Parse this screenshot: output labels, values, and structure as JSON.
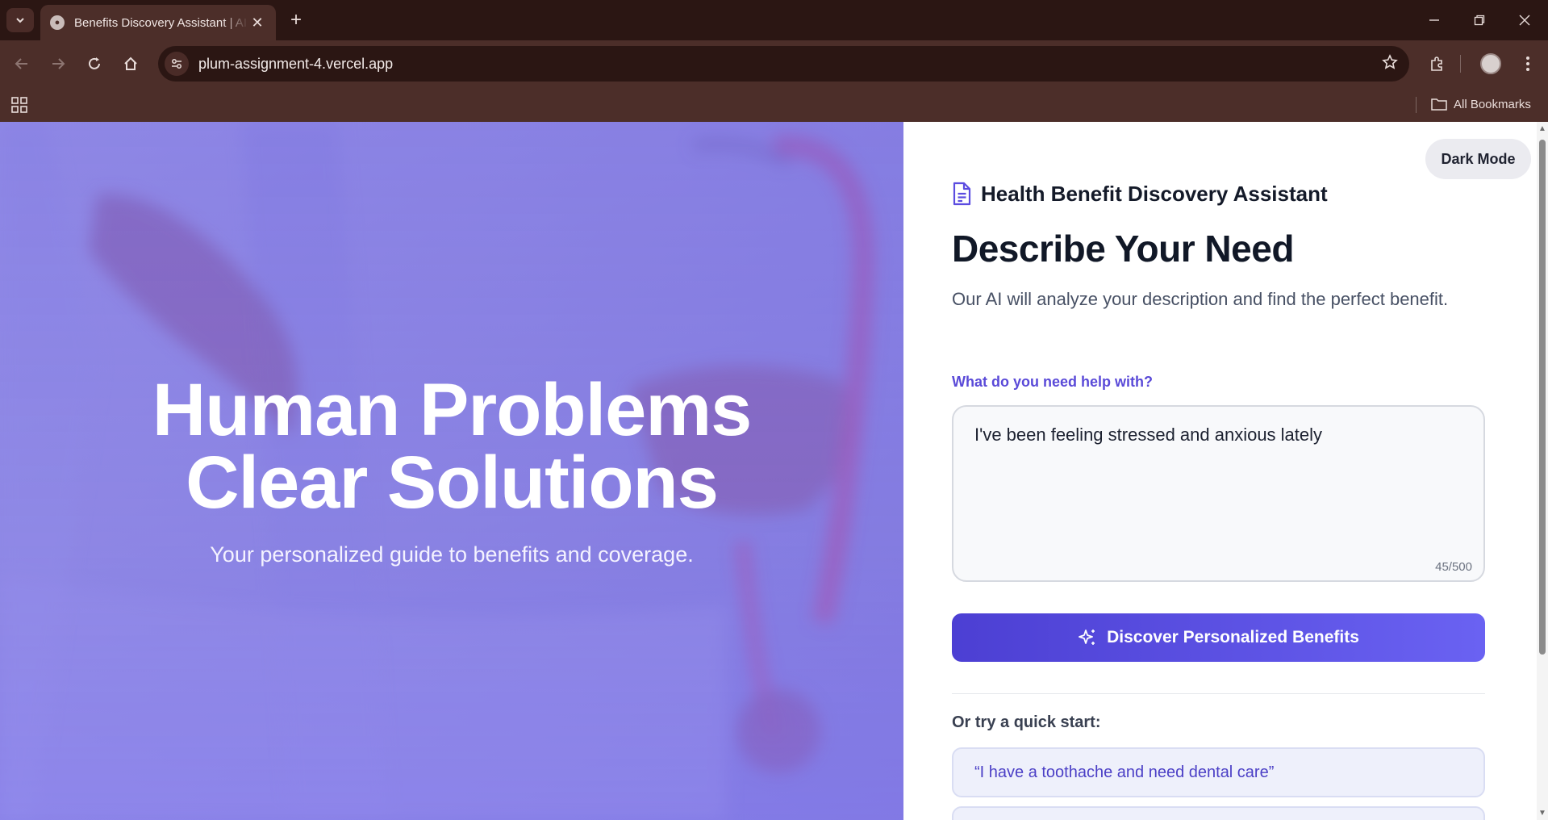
{
  "browser": {
    "tab_title": "Benefits Discovery Assistant | AI",
    "url": "plum-assignment-4.vercel.app",
    "all_bookmarks": "All Bookmarks"
  },
  "hero": {
    "title_line1": "Human Problems",
    "title_line2": "Clear Solutions",
    "subtitle": "Your personalized guide to benefits and coverage."
  },
  "panel": {
    "dark_mode_label": "Dark Mode",
    "app_name": "Health Benefit Discovery Assistant",
    "heading": "Describe Your Need",
    "lede": "Our AI will analyze your description and find the perfect benefit.",
    "field_label": "What do you need help with?",
    "input_value": "I've been feeling stressed and anxious lately",
    "char_count": "45/500",
    "cta_label": "Discover Personalized Benefits",
    "quick_start_title": "Or try a quick start:",
    "quick_starts": [
      "“I have a toothache and need dental care”",
      ""
    ]
  },
  "colors": {
    "accent": "#5b4ce0",
    "cta_start": "#4c3fd3",
    "cta_end": "#6a62f2",
    "browser_frame": "#4c2e29"
  }
}
